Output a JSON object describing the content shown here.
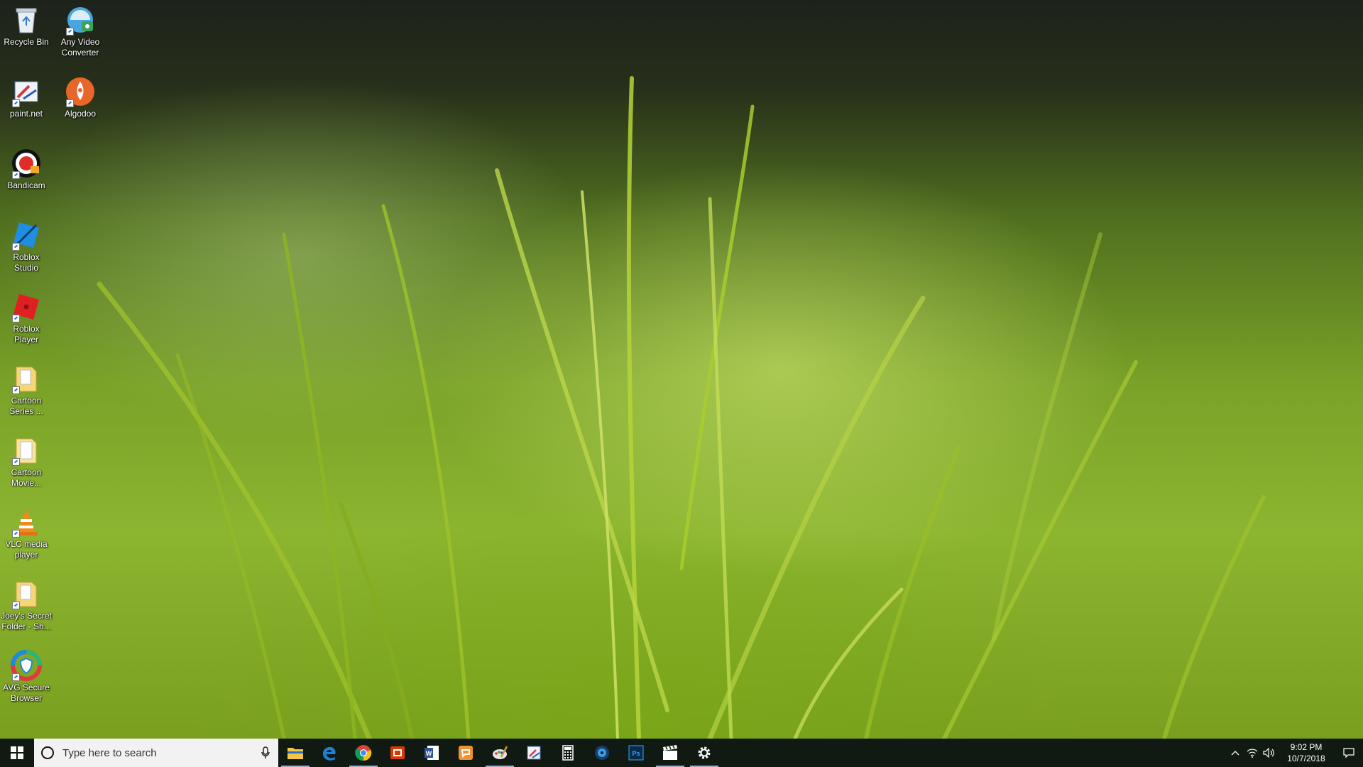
{
  "desktop": {
    "icons": [
      {
        "label": "Recycle Bin",
        "icon": "recycle-bin-icon"
      },
      {
        "label": "Any Video Converter",
        "icon": "any-video-converter-icon"
      },
      {
        "label": "paint.net",
        "icon": "paintnet-icon"
      },
      {
        "label": "Algodoo",
        "icon": "algodoo-icon"
      },
      {
        "label": "Bandicam",
        "icon": "bandicam-icon"
      },
      {
        "label": "Roblox Studio",
        "icon": "roblox-studio-icon"
      },
      {
        "label": "Roblox Player",
        "icon": "roblox-player-icon"
      },
      {
        "label": "Cartoon Series ...",
        "icon": "folder-icon"
      },
      {
        "label": "Cartoon Movie...",
        "icon": "folder-icon"
      },
      {
        "label": "VLC media player",
        "icon": "vlc-icon"
      },
      {
        "label": "Joey's Secret Folder - Sh...",
        "icon": "folder-icon"
      },
      {
        "label": "AVG Secure Browser",
        "icon": "avg-browser-icon"
      }
    ]
  },
  "taskbar": {
    "search_placeholder": "Type here to search",
    "pinned_apps": [
      {
        "name": "File Explorer",
        "icon": "file-explorer-icon",
        "running": true
      },
      {
        "name": "Microsoft Edge",
        "icon": "edge-icon",
        "running": false
      },
      {
        "name": "Google Chrome",
        "icon": "chrome-icon",
        "running": true
      },
      {
        "name": "Office",
        "icon": "office-icon",
        "running": false
      },
      {
        "name": "Word",
        "icon": "word-icon",
        "running": false
      },
      {
        "name": "Slides",
        "icon": "slides-icon",
        "running": false
      },
      {
        "name": "Paint",
        "icon": "paint-icon",
        "running": true
      },
      {
        "name": "paint.net",
        "icon": "paintnet-icon",
        "running": false
      },
      {
        "name": "Calculator",
        "icon": "calculator-icon",
        "running": false
      },
      {
        "name": "Media",
        "icon": "media-icon",
        "running": false
      },
      {
        "name": "Photoshop",
        "icon": "photoshop-icon",
        "running": false
      },
      {
        "name": "Movie Maker",
        "icon": "clapperboard-icon",
        "running": true
      },
      {
        "name": "Settings",
        "icon": "gear-icon",
        "running": true
      }
    ],
    "clock": {
      "time": "9:02 PM",
      "date": "10/7/2018"
    }
  },
  "colors": {
    "taskbar_bg": "#101a12",
    "search_bg": "#f2f2f2",
    "accent_windows": "#ffffff"
  }
}
